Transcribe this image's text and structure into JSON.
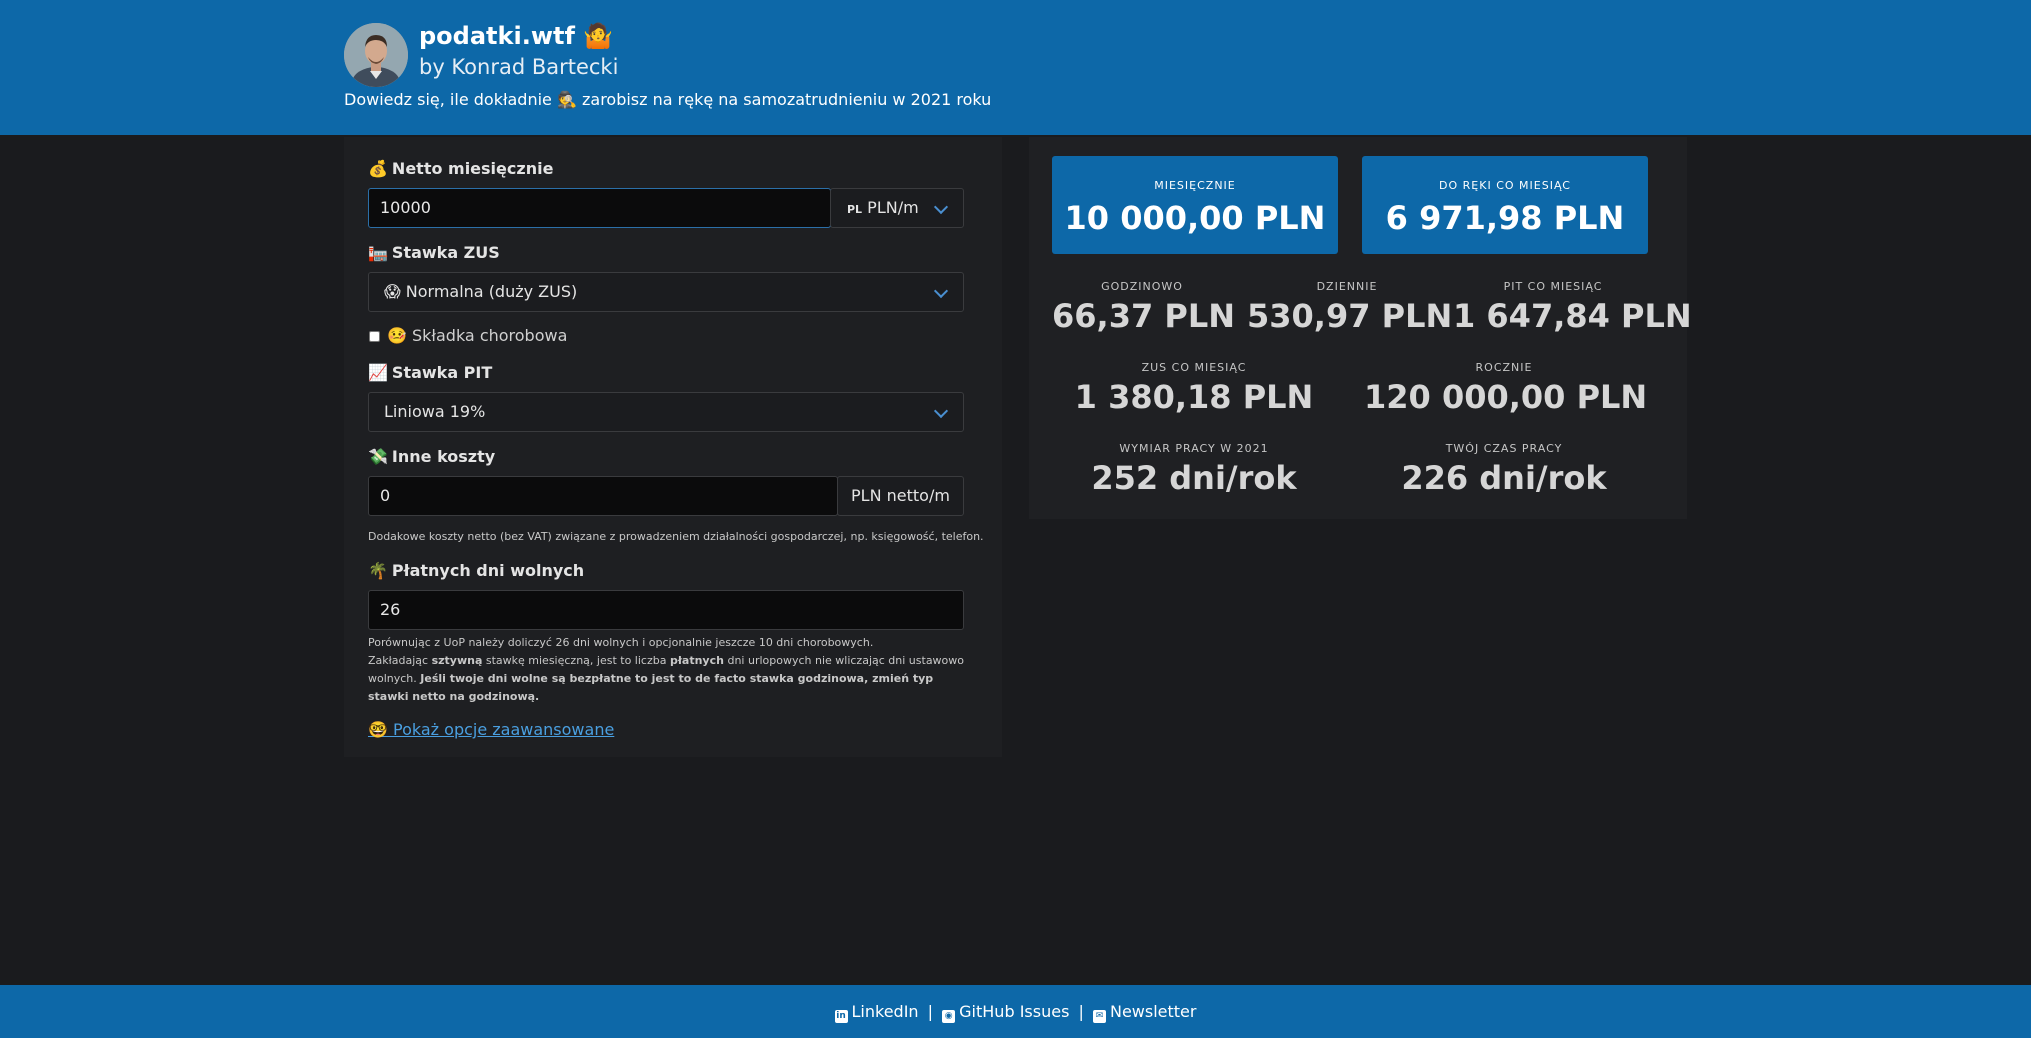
{
  "header": {
    "title": "podatki.wtf 🤷",
    "author": "by Konrad Bartecki",
    "tagline": "Dowiedz się, ile dokładnie 🕵️ zarobisz na rękę na samozatrudnieniu w 2021 roku"
  },
  "form": {
    "netto": {
      "label": "Netto miesięcznie",
      "emoji": "💰",
      "value": "10000",
      "unit_badge": "PL",
      "unit": "PLN/m"
    },
    "zus": {
      "label": "Stawka ZUS",
      "emoji": "🏣",
      "selected": "😱 Normalna (duży ZUS)"
    },
    "sickness": {
      "label": "🤒 Składka chorobowa",
      "checked": false
    },
    "pit": {
      "label": "Stawka PIT",
      "emoji": "📈",
      "selected": "Liniowa 19%"
    },
    "costs": {
      "label": "Inne koszty",
      "emoji": "💸",
      "value": "0",
      "unit": "PLN netto/m",
      "help": "Dodakowe koszty netto (bez VAT) związane z prowadzeniem działalności gospodarczej, np. księgowość, telefon."
    },
    "days_off": {
      "label": "Płatnych dni wolnych",
      "emoji": "🌴",
      "value": "26",
      "help_line1": "Porównując z UoP należy doliczyć 26 dni wolnych i opcjonalnie jeszcze 10 dni chorobowych.",
      "help_line2_a": "Zakładając ",
      "help_line2_b": "sztywną",
      "help_line2_c": " stawkę miesięczną, jest to liczba ",
      "help_line2_d": "płatnych",
      "help_line2_e": " dni urlopowych nie wliczając dni ustawowo wolnych. ",
      "help_line2_f": "Jeśli twoje dni wolne są bezpłatne to jest to de facto stawka godzinowa, zmień typ stawki netto na godzinową."
    },
    "advanced_link": "🤓 Pokaż opcje zaawansowane"
  },
  "results": {
    "monthly": {
      "label": "MIESIĘCZNIE",
      "value": "10 000,00 PLN"
    },
    "take_home": {
      "label": "DO RĘKI CO MIESIĄC",
      "value": "6 971,98 PLN"
    },
    "hourly": {
      "label": "GODZINOWO",
      "value": "66,37 PLN"
    },
    "daily": {
      "label": "DZIENNIE",
      "value": "530,97 PLN"
    },
    "pit_monthly": {
      "label": "PIT CO MIESIĄC",
      "value": "1 647,84 PLN"
    },
    "zus_monthly": {
      "label": "ZUS CO MIESIĄC",
      "value": "1 380,18 PLN"
    },
    "yearly": {
      "label": "ROCZNIE",
      "value": "120 000,00 PLN"
    },
    "work_days_2021": {
      "label": "WYMIAR PRACY W 2021",
      "value": "252 dni/rok"
    },
    "your_work_time": {
      "label": "TWÓJ CZAS PRACY",
      "value": "226 dni/rok"
    }
  },
  "footer": {
    "linkedin": "LinkedIn",
    "github": "GitHub Issues",
    "newsletter": "Newsletter",
    "separator": "|"
  },
  "colors": {
    "brand_blue": "#0d68a8",
    "background": "#1a1b1e",
    "link": "#4a9fe0"
  }
}
